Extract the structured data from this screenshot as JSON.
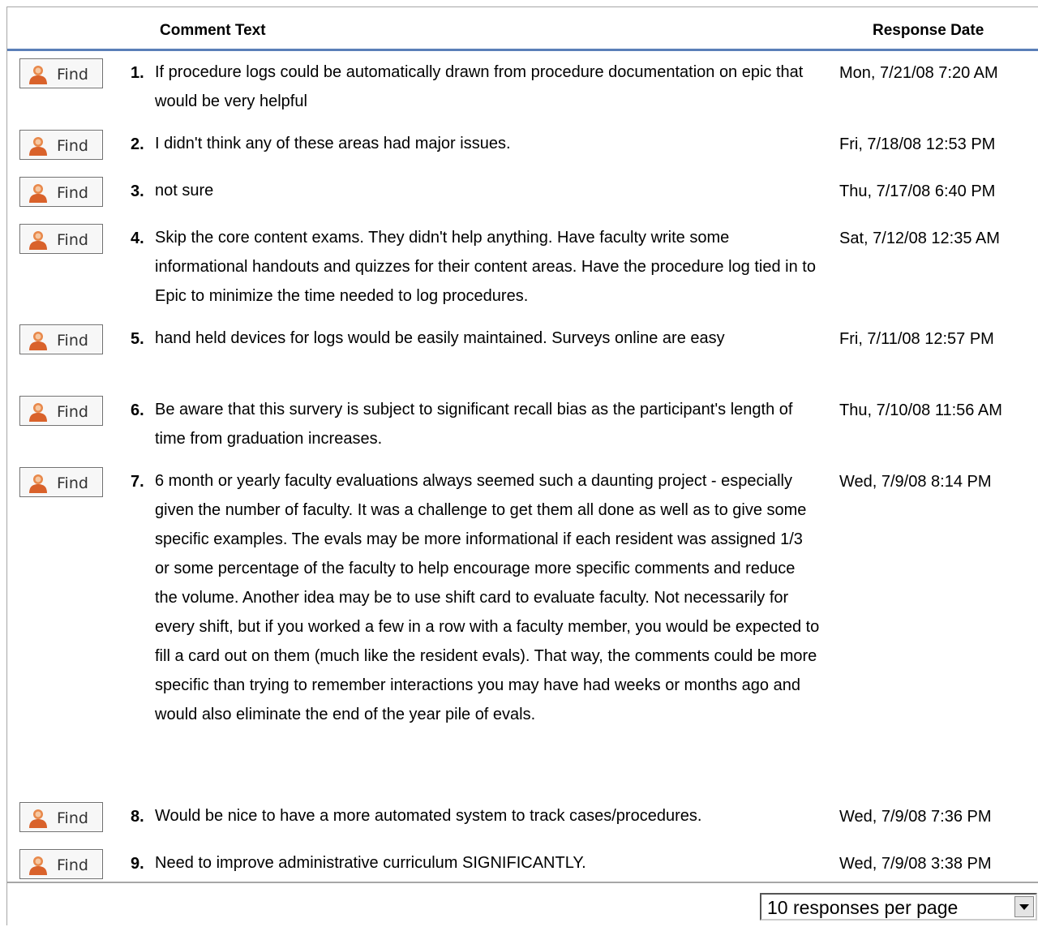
{
  "header": {
    "comment_text": "Comment Text",
    "response_date": "Response Date"
  },
  "find_label": "Find",
  "rows": [
    {
      "num": "1.",
      "text": "If procedure logs could be automatically drawn from procedure documentation on epic that would be very helpful",
      "date": "Mon, 7/21/08 7:20 AM"
    },
    {
      "num": "2.",
      "text": "I didn't think any of these areas had major issues.",
      "date": "Fri, 7/18/08 12:53 PM"
    },
    {
      "num": "3.",
      "text": "not sure",
      "date": "Thu, 7/17/08 6:40 PM"
    },
    {
      "num": "4.",
      "text": "Skip the core content exams. They didn't help anything. Have faculty write some informational handouts and quizzes for their content areas. Have the procedure log tied in to Epic to minimize the time needed to log procedures.",
      "date": "Sat, 7/12/08 12:35 AM"
    },
    {
      "num": "5.",
      "text": "hand held devices for logs would be easily maintained. Surveys online are easy",
      "date": "Fri, 7/11/08 12:57 PM"
    },
    {
      "num": "6.",
      "text": "Be aware that this survery is subject to significant recall bias as the participant's length of time from graduation increases.",
      "date": "Thu, 7/10/08 11:56 AM"
    },
    {
      "num": "7.",
      "text": "6 month or yearly faculty evaluations always seemed such a daunting project - especially given the number of faculty. It was a challenge to get them all done as well as to give some specific examples. The evals may be more informational if each resident was assigned 1/3 or some percentage of the faculty to help encourage more specific comments and reduce the volume. Another idea may be to use shift card to evaluate faculty. Not necessarily for every shift, but if you worked a few in a row with a faculty member, you would be expected to fill a card out on them (much like the resident evals). That way, the comments could be more specific than trying to remember interactions you may have had weeks or months ago and would also eliminate the end of the year pile of evals.",
      "date": "Wed, 7/9/08 8:14 PM"
    },
    {
      "num": "8.",
      "text": "Would be nice to have a more automated system to track cases/procedures.",
      "date": "Wed, 7/9/08 7:36 PM"
    },
    {
      "num": "9.",
      "text": "Need to improve administrative curriculum SIGNIFICANTLY.",
      "date": "Wed, 7/9/08 3:38 PM"
    }
  ],
  "footer": {
    "per_page": "10 responses per page"
  },
  "icons": {
    "find": "person-icon",
    "dropdown": "chevron-down-icon"
  }
}
